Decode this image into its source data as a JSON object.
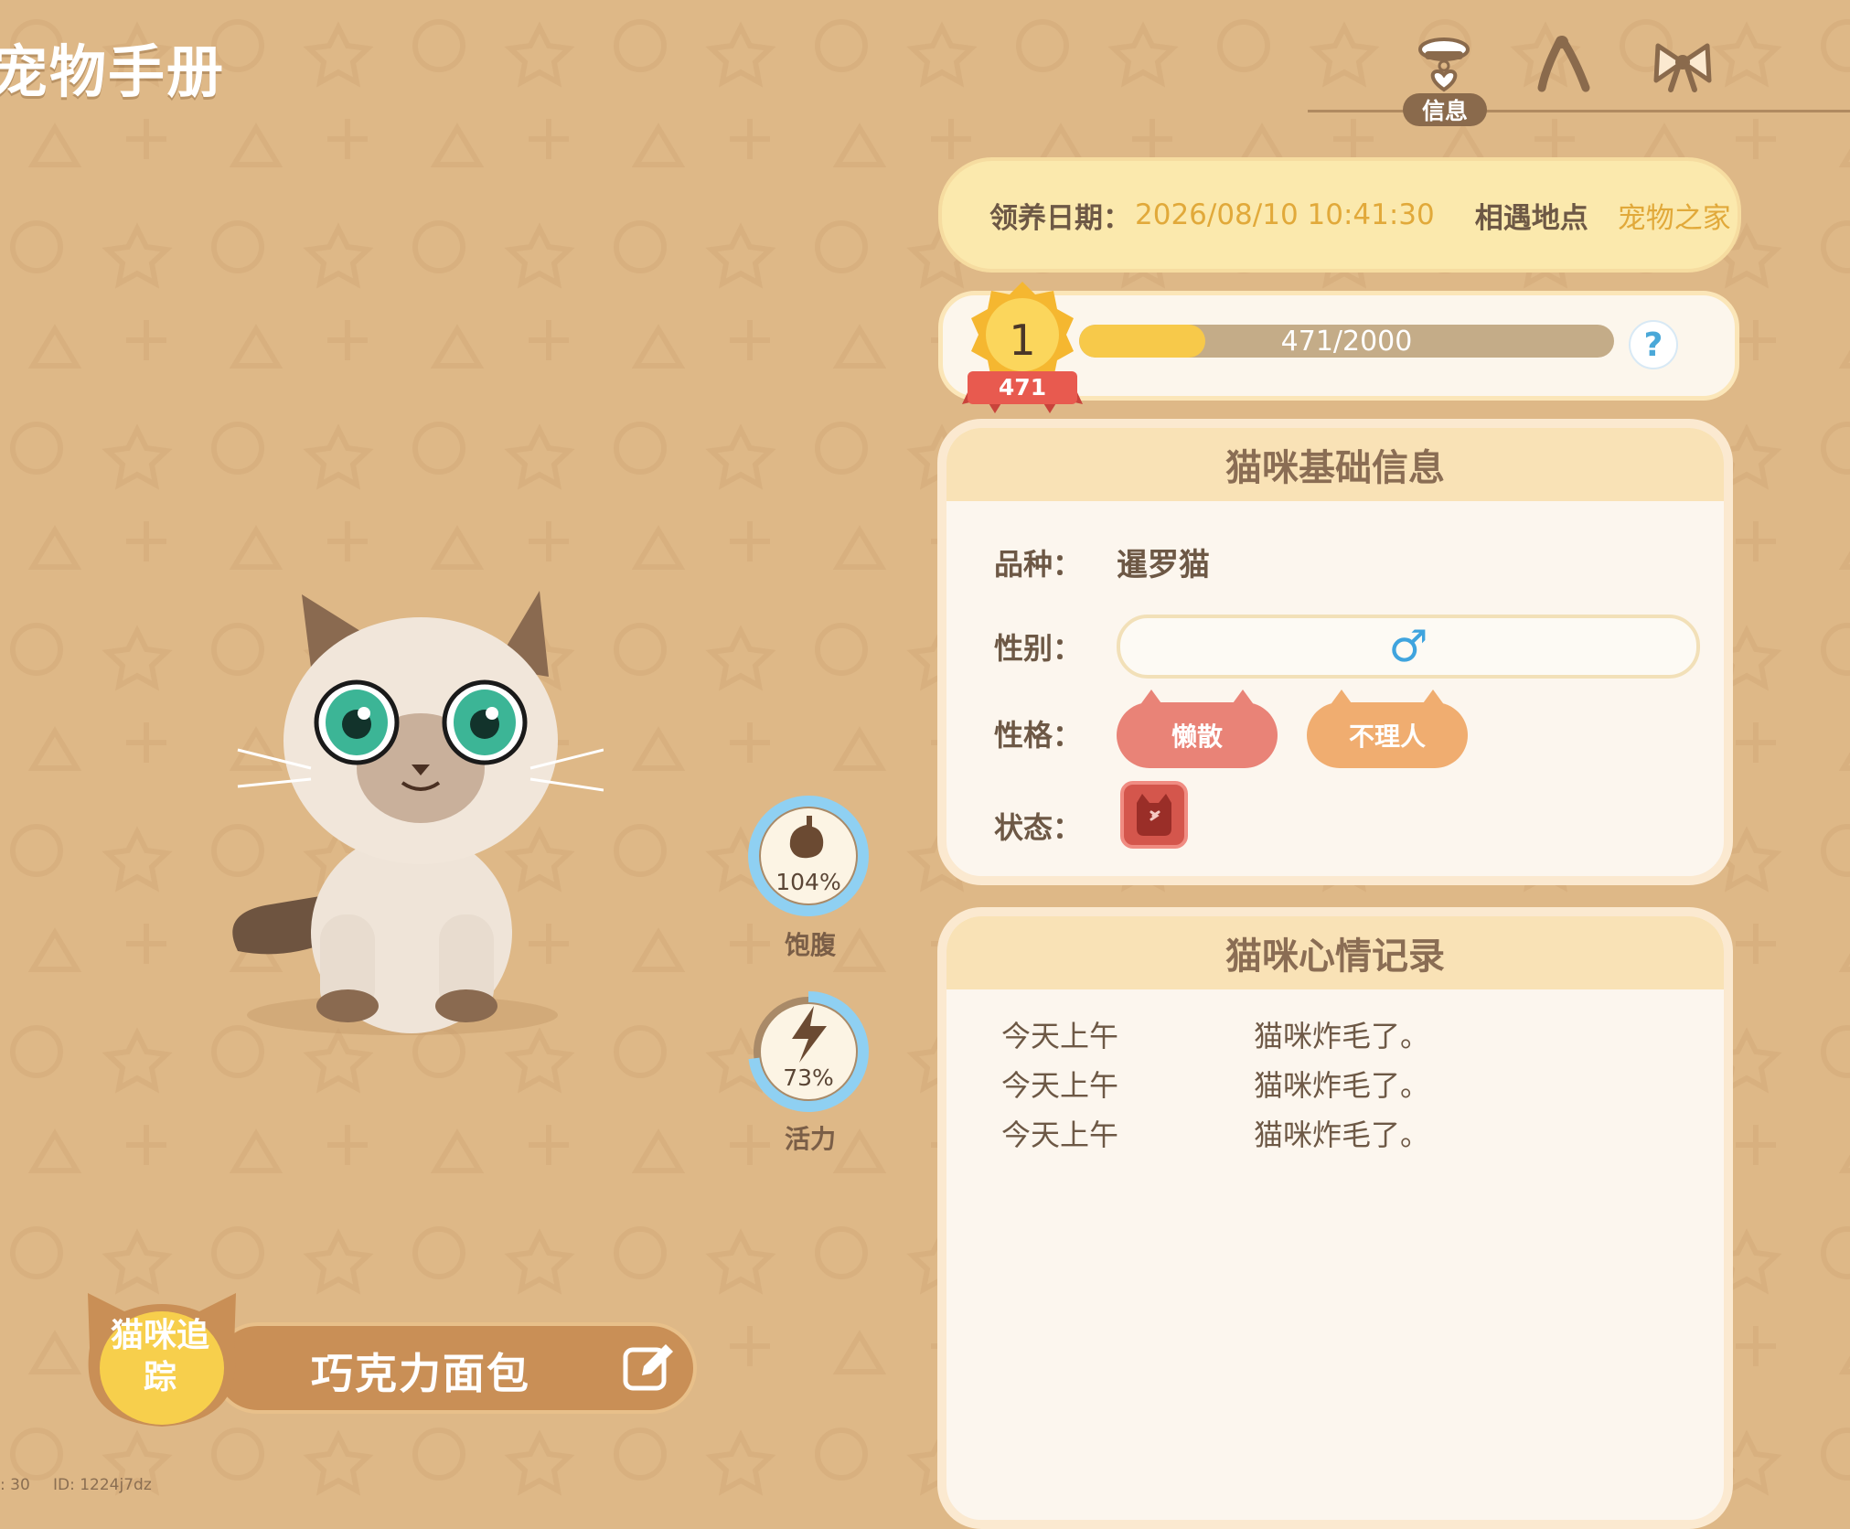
{
  "page_title": "宠物手册",
  "tabs": [
    {
      "icon": "collar-heart-icon",
      "label": "信息",
      "active": true
    },
    {
      "icon": "chicken-leg-icon",
      "label": ""
    },
    {
      "icon": "bow-icon",
      "label": ""
    }
  ],
  "adopt": {
    "date_label": "领养日期：",
    "date_value": "2026/08/10 10:41:30",
    "meet_label": "相遇地点",
    "meet_value": "宠物之家"
  },
  "level": {
    "level": "1",
    "ribbon": "471",
    "progress_text": "471/2000",
    "current": 471,
    "max": 2000,
    "help": "?"
  },
  "basic_info": {
    "title": "猫咪基础信息",
    "breed_label": "品种：",
    "breed_value": "暹罗猫",
    "gender_label": "性别：",
    "gender_symbol": "♂",
    "personality_label": "性格：",
    "personality_tags": [
      "懒散",
      "不理人"
    ],
    "status_label": "状态：",
    "status_icon": "angry-cat-icon"
  },
  "stats": {
    "hunger": {
      "value_text": "104%",
      "label": "饱腹",
      "fraction": 1.04
    },
    "energy": {
      "value_text": "73%",
      "label": "活力",
      "fraction": 0.73
    }
  },
  "mood_log": {
    "title": "猫咪心情记录",
    "entries": [
      {
        "time": "今天上午",
        "text": "猫咪炸毛了。"
      },
      {
        "time": "今天上午",
        "text": "猫咪炸毛了。"
      },
      {
        "time": "今天上午",
        "text": "猫咪炸毛了。"
      }
    ]
  },
  "tracker": {
    "badge_text_line1": "猫咪追",
    "badge_text_line2": "踪",
    "cat_name": "巧克力面包"
  },
  "debug": {
    "fps_text": ": 30",
    "id_text": "ID: 1224j7dz"
  },
  "colors": {
    "background": "#deb887",
    "accent_yellow": "#f7c94a",
    "gender_blue": "#3fa4de",
    "ring_blue": "#8fd0f2"
  }
}
